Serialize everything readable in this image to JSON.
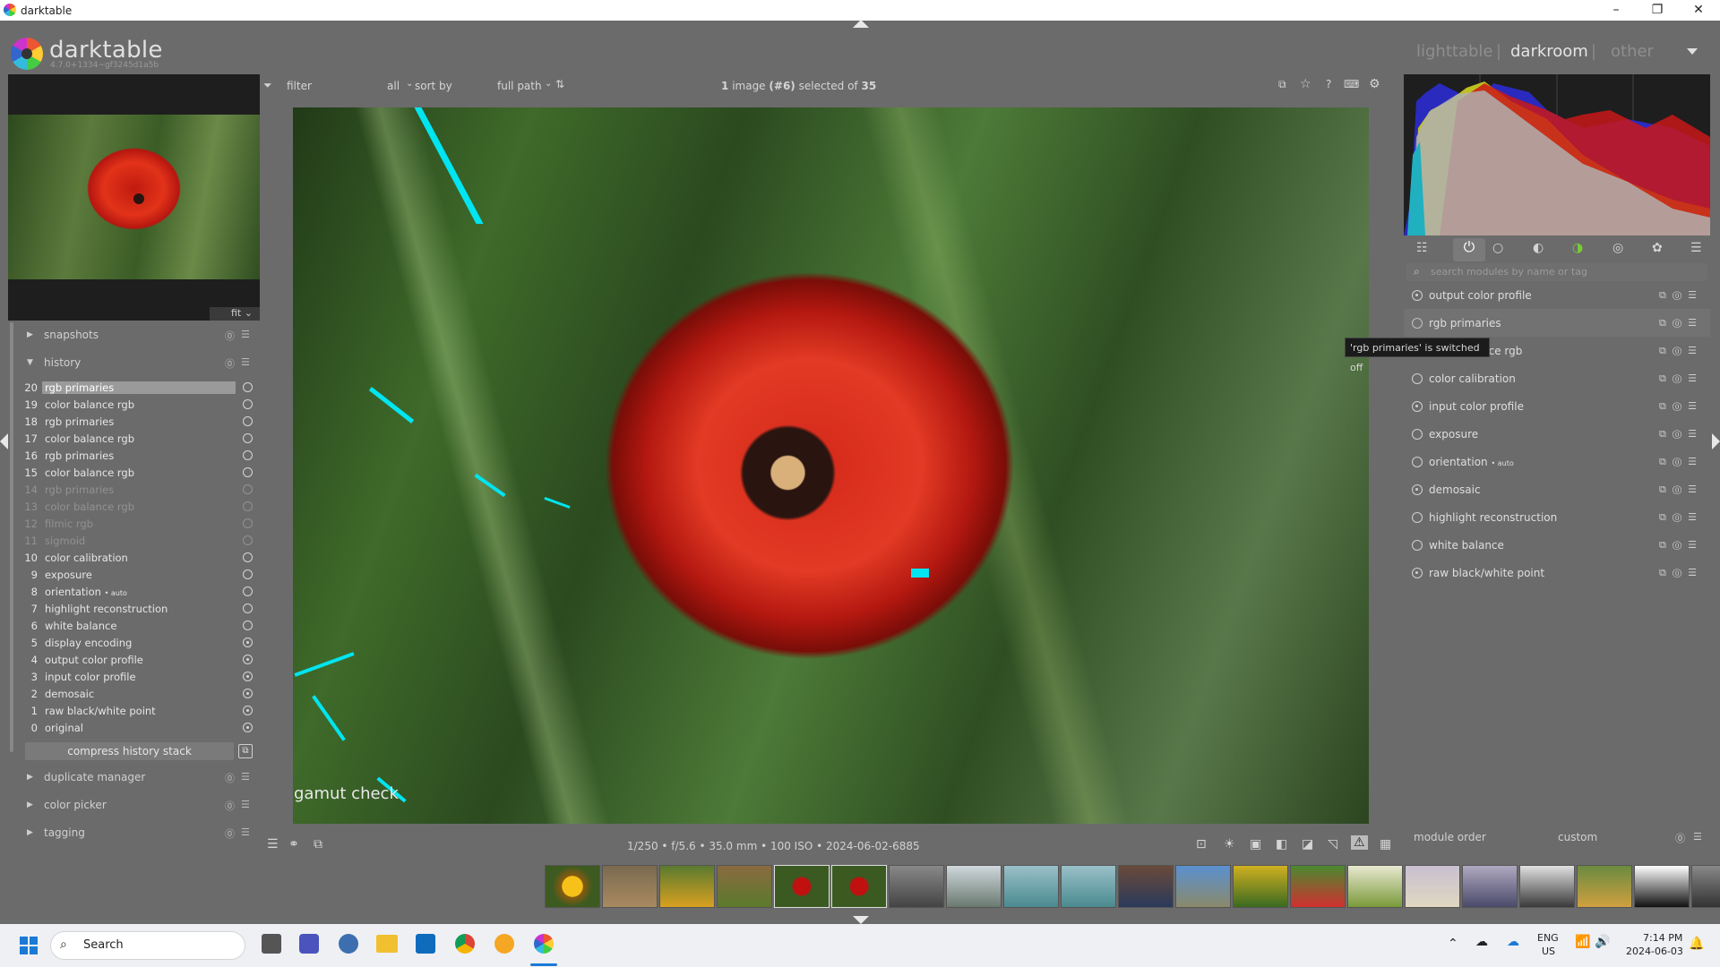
{
  "window": {
    "title": "darktable",
    "minimize": "–",
    "maximize": "❐",
    "close": "✕"
  },
  "header": {
    "app_name": "darktable",
    "version": "4.7.0+1334~gf3245d1a5b",
    "views": {
      "lighttable": "lighttable",
      "darkroom": "darkroom",
      "other": "other"
    },
    "separator": "|"
  },
  "left": {
    "fit_label": "fit",
    "sections": {
      "snapshots": "snapshots",
      "history": "history",
      "duplicate_manager": "duplicate manager",
      "color_picker": "color picker",
      "tagging": "tagging"
    },
    "history": [
      {
        "num": "20",
        "label": "rgb primaries"
      },
      {
        "num": "19",
        "label": "color balance rgb"
      },
      {
        "num": "18",
        "label": "rgb primaries"
      },
      {
        "num": "17",
        "label": "color balance rgb"
      },
      {
        "num": "16",
        "label": "rgb primaries"
      },
      {
        "num": "15",
        "label": "color balance rgb"
      },
      {
        "num": "14",
        "label": "rgb primaries"
      },
      {
        "num": "13",
        "label": "color balance rgb"
      },
      {
        "num": "12",
        "label": "filmic rgb"
      },
      {
        "num": "11",
        "label": "sigmoid"
      },
      {
        "num": "10",
        "label": "color calibration"
      },
      {
        "num": "9",
        "label": "exposure"
      },
      {
        "num": "8",
        "label": "orientation",
        "suffix": "• auto"
      },
      {
        "num": "7",
        "label": "highlight reconstruction"
      },
      {
        "num": "6",
        "label": "white balance"
      },
      {
        "num": "5",
        "label": "display encoding"
      },
      {
        "num": "4",
        "label": "output color profile"
      },
      {
        "num": "3",
        "label": "input color profile"
      },
      {
        "num": "2",
        "label": "demosaic"
      },
      {
        "num": "1",
        "label": "raw black/white point"
      },
      {
        "num": "0",
        "label": "original"
      }
    ],
    "compress_label": "compress history stack"
  },
  "center": {
    "filter_label": "filter",
    "filter_value": "all",
    "sort_label": "sort by",
    "sort_value": "full path",
    "selection": {
      "count": "1",
      "unit": "image",
      "current": "(#6)",
      "mid": "selected of",
      "total": "35"
    },
    "overlay": "gamut check",
    "info": "1/250 • f/5.6 • 35.0 mm • 100 ISO • 2024-06-02-6885"
  },
  "right": {
    "search_placeholder": "search modules by name or tag",
    "modules": [
      {
        "label": "output color profile",
        "power": "fixed"
      },
      {
        "label": "rgb primaries",
        "power": "off"
      },
      {
        "label": "color balance rgb",
        "power": "on"
      },
      {
        "label": "color calibration",
        "power": "on"
      },
      {
        "label": "input color profile",
        "power": "fixed"
      },
      {
        "label": "exposure",
        "power": "on"
      },
      {
        "label": "orientation",
        "suffix": "• auto",
        "power": "on"
      },
      {
        "label": "demosaic",
        "power": "fixed"
      },
      {
        "label": "highlight reconstruction",
        "power": "on"
      },
      {
        "label": "white balance",
        "power": "on"
      },
      {
        "label": "raw black/white point",
        "power": "fixed"
      }
    ],
    "tooltip": "'rgb primaries' is switched off",
    "module_order_label": "module order",
    "module_order_value": "custom"
  },
  "taskbar": {
    "search": "Search",
    "lang": "ENG",
    "region": "US",
    "time": "7:14 PM",
    "date": "2024-06-03"
  },
  "colors": {
    "accent": "#00e5f0",
    "panel": "#6b6b6b",
    "dark": "#1e1e1e"
  }
}
